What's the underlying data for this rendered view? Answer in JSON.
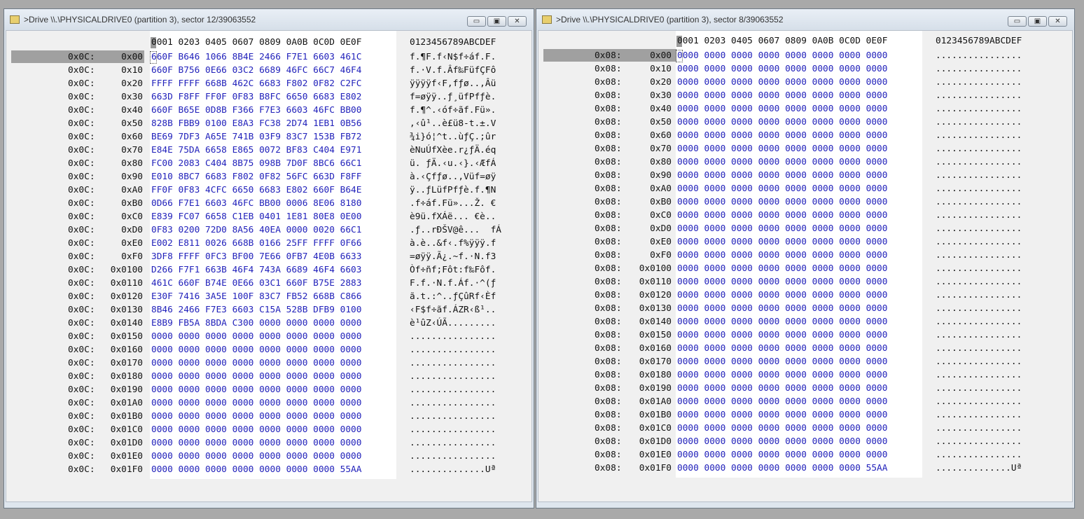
{
  "panes": [
    {
      "title": ">Drive \\\\.\\PHYSICALDRIVE0 (partition 3), sector 12/39063552",
      "header_hex": "0001 0203 0405 0607 0809 0A0B 0C0D 0E0F",
      "header_ascii": "0123456789ABCDEF",
      "rows": [
        {
          "sector": "0x0C:",
          "offset": "0x00",
          "hex": "660F B646 1066 8B4E 2466 F7E1 6603 461C",
          "ascii": "f.¶F.f‹N$f÷áf.F."
        },
        {
          "sector": "0x0C:",
          "offset": "0x10",
          "hex": "660F B756 0E66 03C2 6689 46FC 66C7 46F4",
          "ascii": "f.·V.f.Âf‰FüfÇFô"
        },
        {
          "sector": "0x0C:",
          "offset": "0x20",
          "hex": "FFFF FFFF 668B 462C 6683 F802 0F82 C2FC",
          "ascii": "ÿÿÿÿf‹F,fƒø..‚Âü"
        },
        {
          "sector": "0x0C:",
          "offset": "0x30",
          "hex": "663D F8FF FF0F 0F83 B8FC 6650 6683 E802",
          "ascii": "f=øÿÿ..ƒ¸üfPfƒè."
        },
        {
          "sector": "0x0C:",
          "offset": "0x40",
          "hex": "660F B65E 0D8B F366 F7E3 6603 46FC BB00",
          "ascii": "f.¶^.‹óf÷ãf.Fü»."
        },
        {
          "sector": "0x0C:",
          "offset": "0x50",
          "hex": "828B FBB9 0100 E8A3 FC38 2D74 1EB1 0B56",
          ",‹û¹..è£ü8-t.±.V": ""
        },
        {
          "sector": "0x0C:",
          "offset": "0x60",
          "hex": "BE69 7DF3 A65E 741B 03F9 83C7 153B FB72",
          "ascii": "¾i}ó¦^t..ùƒÇ.;ûr"
        },
        {
          "sector": "0x0C:",
          "offset": "0x70",
          "hex": "E84E 75DA 6658 E865 0072 BF83 C404 E971",
          "ascii": "èNuÚfXèe.r¿ƒÄ.éq"
        },
        {
          "sector": "0x0C:",
          "offset": "0x80",
          "hex": "FC00 2083 C404 8B75 098B 7D0F 8BC6 66C1",
          "ascii": "ü. ƒÄ.‹u.‹}.‹ÆfÁ"
        },
        {
          "sector": "0x0C:",
          "offset": "0x90",
          "hex": "E010 8BC7 6683 F802 0F82 56FC 663D F8FF",
          "ascii": "à.‹Çfƒø..‚Vüf=øÿ"
        },
        {
          "sector": "0x0C:",
          "offset": "0xA0",
          "hex": "FF0F 0F83 4CFC 6650 6683 E802 660F B64E",
          "ascii": "ÿ..ƒLüfPfƒè.f.¶N"
        },
        {
          "sector": "0x0C:",
          "offset": "0xB0",
          "hex": "0D66 F7E1 6603 46FC BB00 0006 8E06 8180",
          "ascii": ".f÷áf.Fü»...Ž. €"
        },
        {
          "sector": "0x0C:",
          "offset": "0xC0",
          "hex": "E839 FC07 6658 C1EB 0401 1E81 80E8 0E00",
          "ascii": "è9ü.fXÁë... €è.."
        },
        {
          "sector": "0x0C:",
          "offset": "0xD0",
          "hex": "0F83 0200 72D0 8A56 40EA 0000 0020 66C1",
          "ascii": ".ƒ..rÐŠV@ê...  fÁ"
        },
        {
          "sector": "0x0C:",
          "offset": "0xE0",
          "hex": "E002 E811 0026 668B 0166 25FF FFFF 0F66",
          "ascii": "à.è..&f‹.f%ÿÿÿ.f"
        },
        {
          "sector": "0x0C:",
          "offset": "0xF0",
          "hex": "3DF8 FFFF 0FC3 BF00 7E66 0FB7 4E0B 6633",
          "ascii": "=øÿÿ.Ã¿.~f.·N.f3"
        },
        {
          "sector": "0x0C:",
          "offset": "0x0100",
          "hex": "D266 F7F1 663B 46F4 743A 6689 46F4 6603",
          "ascii": "Òf÷ñf;Fôt:f‰Fôf."
        },
        {
          "sector": "0x0C:",
          "offset": "0x0110",
          "hex": "461C 660F B74E 0E66 03C1 660F B75E 2883",
          "ascii": "F.f.·N.f.Áf.·^(ƒ"
        },
        {
          "sector": "0x0C:",
          "offset": "0x0120",
          "hex": "E30F 7416 3A5E 100F 83C7 FB52 668B C866",
          "ascii": "ã.t.:^..ƒÇûRf‹Èf"
        },
        {
          "sector": "0x0C:",
          "offset": "0x0130",
          "hex": "8B46 2466 F7E3 6603 C15A 528B DFB9 0100",
          "ascii": "‹F$f÷ãf.ÁZR‹ß¹.."
        },
        {
          "sector": "0x0C:",
          "offset": "0x0140",
          "hex": "E8B9 FB5A 8BDA C300 0000 0000 0000 0000",
          "ascii": "è¹ûZ‹ÚÃ........."
        },
        {
          "sector": "0x0C:",
          "offset": "0x0150",
          "hex": "0000 0000 0000 0000 0000 0000 0000 0000",
          "ascii": "................"
        },
        {
          "sector": "0x0C:",
          "offset": "0x0160",
          "hex": "0000 0000 0000 0000 0000 0000 0000 0000",
          "ascii": "................"
        },
        {
          "sector": "0x0C:",
          "offset": "0x0170",
          "hex": "0000 0000 0000 0000 0000 0000 0000 0000",
          "ascii": "................"
        },
        {
          "sector": "0x0C:",
          "offset": "0x0180",
          "hex": "0000 0000 0000 0000 0000 0000 0000 0000",
          "ascii": "................"
        },
        {
          "sector": "0x0C:",
          "offset": "0x0190",
          "hex": "0000 0000 0000 0000 0000 0000 0000 0000",
          "ascii": "................"
        },
        {
          "sector": "0x0C:",
          "offset": "0x01A0",
          "hex": "0000 0000 0000 0000 0000 0000 0000 0000",
          "ascii": "................"
        },
        {
          "sector": "0x0C:",
          "offset": "0x01B0",
          "hex": "0000 0000 0000 0000 0000 0000 0000 0000",
          "ascii": "................"
        },
        {
          "sector": "0x0C:",
          "offset": "0x01C0",
          "hex": "0000 0000 0000 0000 0000 0000 0000 0000",
          "ascii": "................"
        },
        {
          "sector": "0x0C:",
          "offset": "0x01D0",
          "hex": "0000 0000 0000 0000 0000 0000 0000 0000",
          "ascii": "................"
        },
        {
          "sector": "0x0C:",
          "offset": "0x01E0",
          "hex": "0000 0000 0000 0000 0000 0000 0000 0000",
          "ascii": "................"
        },
        {
          "sector": "0x0C:",
          "offset": "0x01F0",
          "hex": "0000 0000 0000 0000 0000 0000 0000 55AA",
          "ascii": "..............Uª"
        }
      ]
    },
    {
      "title": ">Drive \\\\.\\PHYSICALDRIVE0 (partition 3), sector 8/39063552",
      "header_hex": "0001 0203 0405 0607 0809 0A0B 0C0D 0E0F",
      "header_ascii": "0123456789ABCDEF",
      "rows": [
        {
          "sector": "0x08:",
          "offset": "0x00",
          "hex": "0000 0000 0000 0000 0000 0000 0000 0000",
          "ascii": "................"
        },
        {
          "sector": "0x08:",
          "offset": "0x10",
          "hex": "0000 0000 0000 0000 0000 0000 0000 0000",
          "ascii": "................"
        },
        {
          "sector": "0x08:",
          "offset": "0x20",
          "hex": "0000 0000 0000 0000 0000 0000 0000 0000",
          "ascii": "................"
        },
        {
          "sector": "0x08:",
          "offset": "0x30",
          "hex": "0000 0000 0000 0000 0000 0000 0000 0000",
          "ascii": "................"
        },
        {
          "sector": "0x08:",
          "offset": "0x40",
          "hex": "0000 0000 0000 0000 0000 0000 0000 0000",
          "ascii": "................"
        },
        {
          "sector": "0x08:",
          "offset": "0x50",
          "hex": "0000 0000 0000 0000 0000 0000 0000 0000",
          "ascii": "................"
        },
        {
          "sector": "0x08:",
          "offset": "0x60",
          "hex": "0000 0000 0000 0000 0000 0000 0000 0000",
          "ascii": "................"
        },
        {
          "sector": "0x08:",
          "offset": "0x70",
          "hex": "0000 0000 0000 0000 0000 0000 0000 0000",
          "ascii": "................"
        },
        {
          "sector": "0x08:",
          "offset": "0x80",
          "hex": "0000 0000 0000 0000 0000 0000 0000 0000",
          "ascii": "................"
        },
        {
          "sector": "0x08:",
          "offset": "0x90",
          "hex": "0000 0000 0000 0000 0000 0000 0000 0000",
          "ascii": "................"
        },
        {
          "sector": "0x08:",
          "offset": "0xA0",
          "hex": "0000 0000 0000 0000 0000 0000 0000 0000",
          "ascii": "................"
        },
        {
          "sector": "0x08:",
          "offset": "0xB0",
          "hex": "0000 0000 0000 0000 0000 0000 0000 0000",
          "ascii": "................"
        },
        {
          "sector": "0x08:",
          "offset": "0xC0",
          "hex": "0000 0000 0000 0000 0000 0000 0000 0000",
          "ascii": "................"
        },
        {
          "sector": "0x08:",
          "offset": "0xD0",
          "hex": "0000 0000 0000 0000 0000 0000 0000 0000",
          "ascii": "................"
        },
        {
          "sector": "0x08:",
          "offset": "0xE0",
          "hex": "0000 0000 0000 0000 0000 0000 0000 0000",
          "ascii": "................"
        },
        {
          "sector": "0x08:",
          "offset": "0xF0",
          "hex": "0000 0000 0000 0000 0000 0000 0000 0000",
          "ascii": "................"
        },
        {
          "sector": "0x08:",
          "offset": "0x0100",
          "hex": "0000 0000 0000 0000 0000 0000 0000 0000",
          "ascii": "................"
        },
        {
          "sector": "0x08:",
          "offset": "0x0110",
          "hex": "0000 0000 0000 0000 0000 0000 0000 0000",
          "ascii": "................"
        },
        {
          "sector": "0x08:",
          "offset": "0x0120",
          "hex": "0000 0000 0000 0000 0000 0000 0000 0000",
          "ascii": "................"
        },
        {
          "sector": "0x08:",
          "offset": "0x0130",
          "hex": "0000 0000 0000 0000 0000 0000 0000 0000",
          "ascii": "................"
        },
        {
          "sector": "0x08:",
          "offset": "0x0140",
          "hex": "0000 0000 0000 0000 0000 0000 0000 0000",
          "ascii": "................"
        },
        {
          "sector": "0x08:",
          "offset": "0x0150",
          "hex": "0000 0000 0000 0000 0000 0000 0000 0000",
          "ascii": "................"
        },
        {
          "sector": "0x08:",
          "offset": "0x0160",
          "hex": "0000 0000 0000 0000 0000 0000 0000 0000",
          "ascii": "................"
        },
        {
          "sector": "0x08:",
          "offset": "0x0170",
          "hex": "0000 0000 0000 0000 0000 0000 0000 0000",
          "ascii": "................"
        },
        {
          "sector": "0x08:",
          "offset": "0x0180",
          "hex": "0000 0000 0000 0000 0000 0000 0000 0000",
          "ascii": "................"
        },
        {
          "sector": "0x08:",
          "offset": "0x0190",
          "hex": "0000 0000 0000 0000 0000 0000 0000 0000",
          "ascii": "................"
        },
        {
          "sector": "0x08:",
          "offset": "0x01A0",
          "hex": "0000 0000 0000 0000 0000 0000 0000 0000",
          "ascii": "................"
        },
        {
          "sector": "0x08:",
          "offset": "0x01B0",
          "hex": "0000 0000 0000 0000 0000 0000 0000 0000",
          "ascii": "................"
        },
        {
          "sector": "0x08:",
          "offset": "0x01C0",
          "hex": "0000 0000 0000 0000 0000 0000 0000 0000",
          "ascii": "................"
        },
        {
          "sector": "0x08:",
          "offset": "0x01D0",
          "hex": "0000 0000 0000 0000 0000 0000 0000 0000",
          "ascii": "................"
        },
        {
          "sector": "0x08:",
          "offset": "0x01E0",
          "hex": "0000 0000 0000 0000 0000 0000 0000 0000",
          "ascii": "................"
        },
        {
          "sector": "0x08:",
          "offset": "0x01F0",
          "hex": "0000 0000 0000 0000 0000 0000 0000 55AA",
          "ascii": "..............Uª"
        }
      ]
    }
  ],
  "window_buttons": {
    "minimize": "▭",
    "maximize": "▣",
    "close": "✕"
  },
  "icons": {
    "title": "drive-folder-icon"
  },
  "colors": {
    "hex_text": "#2222bb",
    "selected_row": "#a0a0a0",
    "client_bg": "#f0f0f0",
    "title_bg": "#dfe6ee"
  }
}
